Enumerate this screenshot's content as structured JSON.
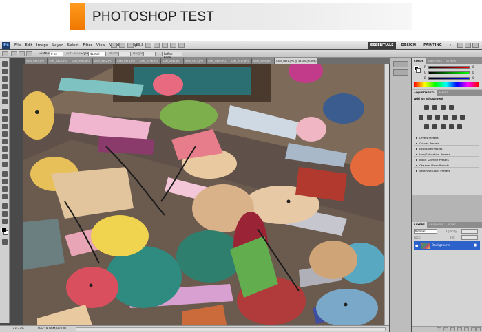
{
  "banner": {
    "title": "PHOTOSHOP TEST"
  },
  "menubar": {
    "logo": "Ps",
    "items": [
      "File",
      "Edit",
      "Image",
      "Layer",
      "Select",
      "Filter",
      "View",
      "Window",
      "Help"
    ],
    "zoom": "33.3",
    "workspaces": [
      "ESSENTIALS",
      "DESIGN",
      "PAINTING"
    ],
    "workspace_more": "»"
  },
  "options": {
    "feather_label": "Feather:",
    "feather_value": "0 px",
    "antialias_label": "Anti-alias",
    "style_label": "Style:",
    "style_value": "Normal",
    "width_label": "Width:",
    "height_label": "Height:",
    "refine_label": "Refine Edge..."
  },
  "tabs": [
    "SAM_5049.JPG",
    "SAM_5405.JPG",
    "SAM_5461.JPG",
    "SAM_5462.JPG",
    "SAM_5574.JPG",
    "SAM_5576.JPG",
    "SAM_5541.JPG",
    "SAM_5543.JPG",
    "SAM_5490.JPG",
    "SAM_5537.JPG",
    "SAM_5508.JPG",
    "SAM_5851.JPG @ 33.3% (RGB/8)"
  ],
  "status": {
    "zoom": "33.33%",
    "doc": "Doc: 9.00M/9.00M"
  },
  "panels": {
    "color_tabs": [
      "COLOR",
      "SWATCHES",
      "STYLES"
    ],
    "color_labels": [
      "R",
      "G",
      "B"
    ],
    "color_values": [
      "0",
      "0",
      "0"
    ],
    "adjust_tabs": [
      "ADJUSTMENTS",
      "MASKS"
    ],
    "adjust_title": "Add an adjustment",
    "presets": [
      "Levels Presets",
      "Curves Presets",
      "Exposure Presets",
      "Hue/Saturation Presets",
      "Black & White Presets",
      "Channel Mixer Presets",
      "Selective Color Presets"
    ],
    "layers_tabs": [
      "LAYERS",
      "CHANNELS",
      "PATHS"
    ],
    "blend_mode": "Normal",
    "opacity_label": "Opacity:",
    "lock_label": "Lock:",
    "fill_label": "Fill:",
    "layer_name": "Background"
  },
  "colors": {
    "accent": "#f07800",
    "selection": "#2c62c9"
  }
}
